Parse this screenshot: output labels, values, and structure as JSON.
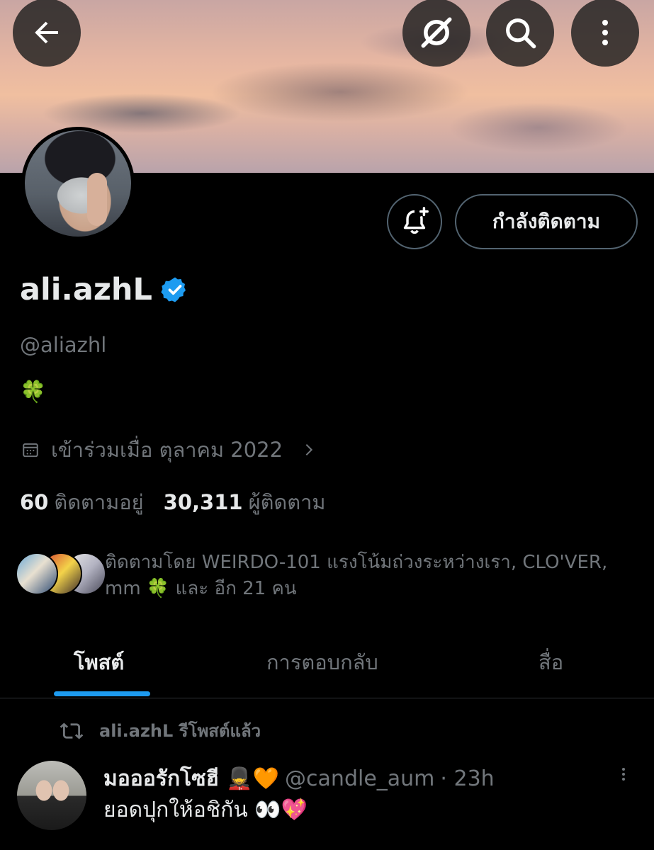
{
  "header": {
    "back_icon": "arrow-left-icon",
    "grok_icon": "grok-icon",
    "search_icon": "search-icon",
    "more_icon": "more-vertical-icon"
  },
  "profile": {
    "display_name": "ali.azhL",
    "verified_icon": "verified-badge-icon",
    "handle": "@aliazhl",
    "bio": "🍀",
    "joined": "เข้าร่วมเมื่อ ตุลาคม 2022",
    "following_count": "60",
    "following_label": "ติดตามอยู่",
    "followers_count": "30,311",
    "followers_label": "ผู้ติดตาม",
    "followed_by": "ติดตามโดย WEIRDO-101 แรงโน้มถ่วงระหว่างเรา, CLO'VER, mm 🍀 และ อีก 21 คน"
  },
  "actions": {
    "notify_icon": "bell-plus-icon",
    "following_button": "กำลังติดตาม"
  },
  "tabs": [
    {
      "label": "โพสต์",
      "active": true
    },
    {
      "label": "การตอบกลับ",
      "active": false
    },
    {
      "label": "สื่อ",
      "active": false
    }
  ],
  "post": {
    "repost_label": "ali.azhL รีโพสต์แล้ว",
    "author_name": "มอออรักโซฮี 💂🧡",
    "author_handle": "@candle_aum",
    "time": "· 23h",
    "text": "ยอดปุกให้อชิกัน 👀💖"
  },
  "colors": {
    "accent": "#1d9bf0",
    "background": "#000000",
    "text_primary": "#e7e9ea",
    "text_secondary": "#71767b",
    "border": "#536471"
  }
}
